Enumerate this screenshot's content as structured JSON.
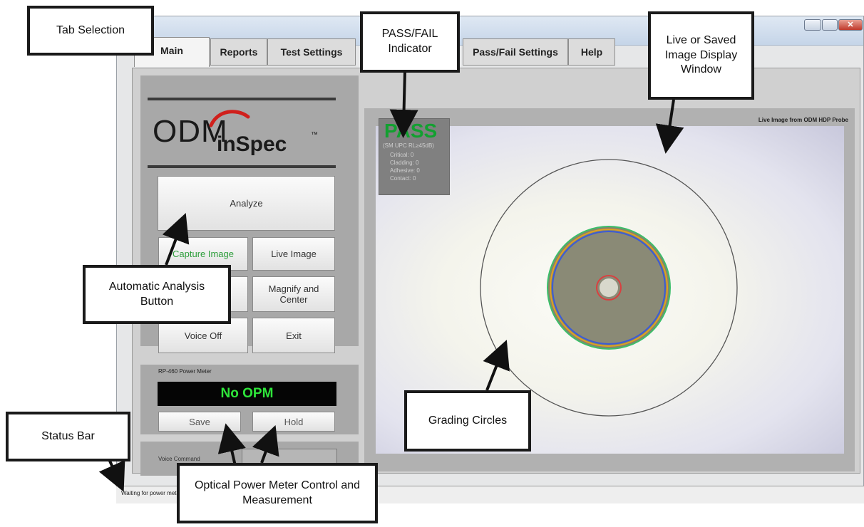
{
  "window": {
    "title": "inSpec"
  },
  "tabs": [
    {
      "label": "Main"
    },
    {
      "label": "Reports"
    },
    {
      "label": "Test Settings"
    },
    {
      "label": "Pass/Fail Settings"
    },
    {
      "label": "Help"
    }
  ],
  "logo": {
    "brand": "ODM",
    "product": "inSpec",
    "tm": "™"
  },
  "buttons": {
    "analyze": "Analyze",
    "capture_image": "Capture Image",
    "live_image": "Live Image",
    "magnify_center": "Magnify and Center",
    "voice_off": "Voice Off",
    "exit": "Exit",
    "save": "Save",
    "hold": "Hold"
  },
  "power_meter": {
    "title": "RP-460 Power Meter",
    "reading": "No OPM"
  },
  "voice": {
    "label": "Voice Command"
  },
  "image_window": {
    "header": "Live Image from ODM HDP Probe"
  },
  "result": {
    "status": "PASS",
    "profile": "(SM UPC RL≥45dB)",
    "critical": "Critical: 0",
    "cladding": "Cladding: 0",
    "adhesive": "Adhesive: 0",
    "contact": "Contact: 0"
  },
  "status_bar": {
    "text": "Waiting for power meter..."
  },
  "callouts": {
    "tab_selection": "Tab Selection",
    "pass_fail": "PASS/FAIL Indicator",
    "live_saved": "Live or Saved Image Display Window",
    "automatic_analysis": "Automatic Analysis Button",
    "grading_circles": "Grading Circles",
    "status_bar": "Status Bar",
    "opm_control": "Optical Power Meter Control and Measurement"
  },
  "colors": {
    "pass_green": "#12a030",
    "opm_green": "#2ee53a",
    "capture_green": "#2e9e3c",
    "logo_swoosh": "#d0201c",
    "zone_core": "#d94040",
    "zone_cladding": "#3c5bd6",
    "zone_adhesive": "#e0a020",
    "zone_contact": "#3cbf6a"
  }
}
